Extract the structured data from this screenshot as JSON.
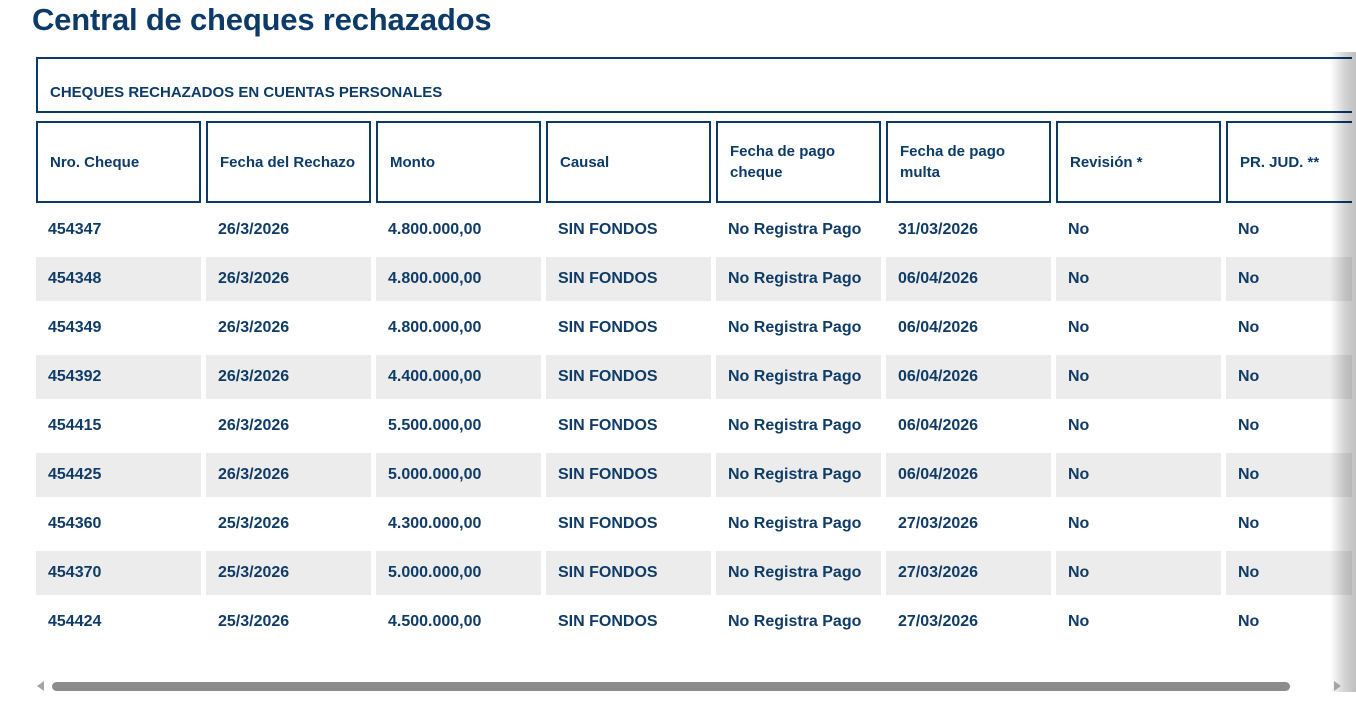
{
  "page": {
    "title": "Central de cheques rechazados"
  },
  "section": {
    "title": "CHEQUES RECHAZADOS EN CUENTAS PERSONALES"
  },
  "table": {
    "headers": [
      "Nro. Cheque",
      "Fecha del Rechazo",
      "Monto",
      "Causal",
      "Fecha de pago cheque",
      "Fecha de pago multa",
      "Revisión *",
      "PR. JUD. **"
    ],
    "rows": [
      [
        "454347",
        "26/3/2026",
        "4.800.000,00",
        "SIN FONDOS",
        "No Registra Pago",
        "31/03/2026",
        "No",
        "No"
      ],
      [
        "454348",
        "26/3/2026",
        "4.800.000,00",
        "SIN FONDOS",
        "No Registra Pago",
        "06/04/2026",
        "No",
        "No"
      ],
      [
        "454349",
        "26/3/2026",
        "4.800.000,00",
        "SIN FONDOS",
        "No Registra Pago",
        "06/04/2026",
        "No",
        "No"
      ],
      [
        "454392",
        "26/3/2026",
        "4.400.000,00",
        "SIN FONDOS",
        "No Registra Pago",
        "06/04/2026",
        "No",
        "No"
      ],
      [
        "454415",
        "26/3/2026",
        "5.500.000,00",
        "SIN FONDOS",
        "No Registra Pago",
        "06/04/2026",
        "No",
        "No"
      ],
      [
        "454425",
        "26/3/2026",
        "5.000.000,00",
        "SIN FONDOS",
        "No Registra Pago",
        "06/04/2026",
        "No",
        "No"
      ],
      [
        "454360",
        "25/3/2026",
        "4.300.000,00",
        "SIN FONDOS",
        "No Registra Pago",
        "27/03/2026",
        "No",
        "No"
      ],
      [
        "454370",
        "25/3/2026",
        "5.000.000,00",
        "SIN FONDOS",
        "No Registra Pago",
        "27/03/2026",
        "No",
        "No"
      ],
      [
        "454424",
        "25/3/2026",
        "4.500.000,00",
        "SIN FONDOS",
        "No Registra Pago",
        "27/03/2026",
        "No",
        "No"
      ]
    ]
  },
  "scrollbar": {
    "left_icon": "chevron-left-icon",
    "right_icon": "chevron-right-icon"
  },
  "colors": {
    "primary": "#0c3b69",
    "row_alt": "#ececec"
  }
}
